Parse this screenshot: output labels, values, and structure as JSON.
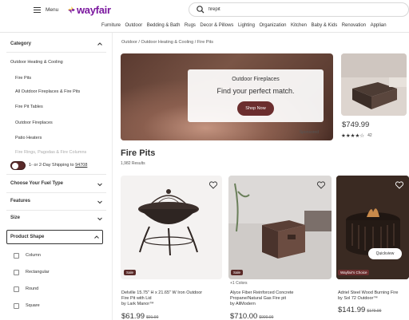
{
  "header": {
    "menu_label": "Menu",
    "logo_text": "wayfair",
    "search_value": "firepit",
    "brand_color": "#7b189f"
  },
  "category_nav": [
    "Furniture",
    "Outdoor",
    "Bedding & Bath",
    "Rugs",
    "Decor & Pillows",
    "Lighting",
    "Organization",
    "Kitchen",
    "Baby & Kids",
    "Renovation",
    "Applian"
  ],
  "sidebar": {
    "category_heading": "Category",
    "category_top": "Outdoor Heating & Cooling",
    "category_items": [
      "Fire Pits",
      "All Outdoor Fireplaces & Fire Pits",
      "Fire Pit Tables",
      "Outdoor Fireplaces",
      "Patio Heaters",
      "Fire Rings, Pagodas & Fire Columns"
    ],
    "shipping_text": "1- or 2-Day Shipping to",
    "shipping_zip": "94708",
    "fuel_heading": "Choose Your Fuel Type",
    "features_heading": "Features",
    "size_heading": "Size",
    "shape_heading": "Product Shape",
    "shape_options": [
      "Column",
      "Rectangular",
      "Round",
      "Square"
    ]
  },
  "main": {
    "breadcrumb": [
      "Outdoor",
      "Outdoor Heating & Cooling",
      "Fire Pits"
    ],
    "hero": {
      "subtitle": "Outdoor Fireplaces",
      "title": "Find your perfect match.",
      "button": "Shop Now",
      "sponsored": "Sponsored"
    },
    "side_product": {
      "price": "$749.99",
      "stars": "★★★★☆",
      "rating_count": "42"
    },
    "page_title": "Fire Pits",
    "results": "1,982 Results",
    "products": [
      {
        "badge": "Sale",
        "name_line1": "Delville 15.75\" H x 21.65\" W Iron Outdoor",
        "name_line2": "Fire Pit with Lid",
        "brand": "by Lark Manor™",
        "price": "$61.99",
        "old_price": "$91.99"
      },
      {
        "badge": "Sale",
        "colors": "+1 Colors",
        "name_line1": "Alyce Fiber Reinforced Concrete",
        "name_line2": "Propane/Natural Gas Fire pit",
        "brand": "by AllModern",
        "price": "$710.00",
        "old_price": "$900.99"
      },
      {
        "badge": "Wayfair's Choice",
        "quickview": "Quickview",
        "name_line1": "Adriel Steel Wood Burning Fire",
        "name_line2": "by Sol 72 Outdoor™",
        "price": "$141.99",
        "old_price": "$179.99"
      }
    ]
  }
}
